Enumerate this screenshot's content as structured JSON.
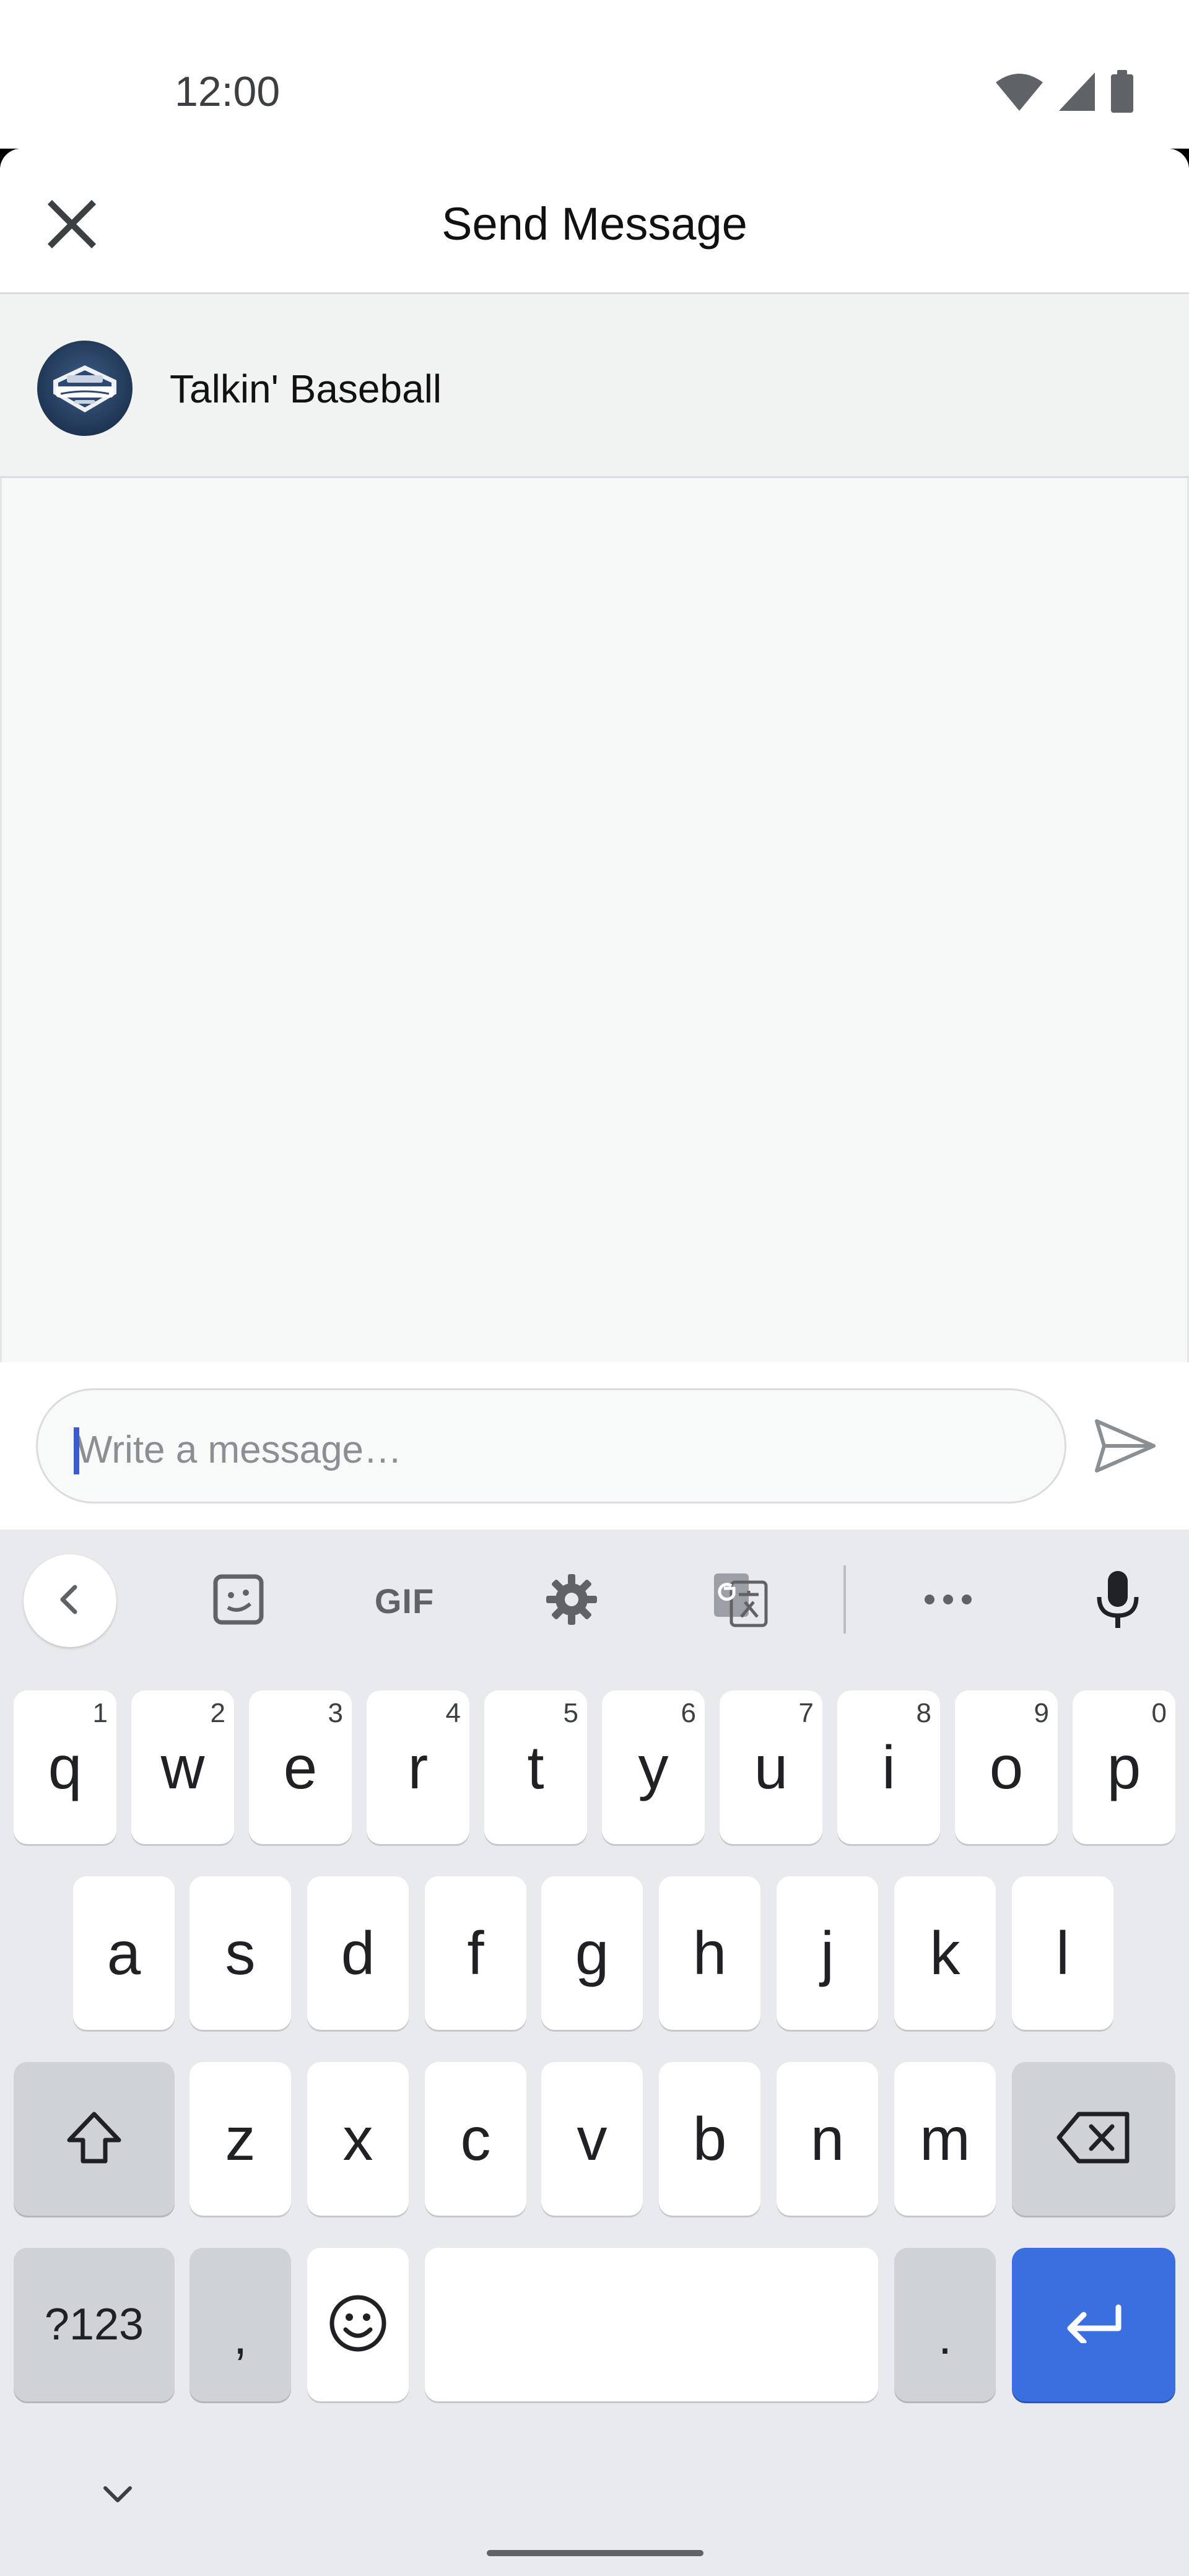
{
  "status_bar": {
    "time": "12:00",
    "icons": [
      "wifi-icon",
      "signal-icon",
      "battery-icon"
    ]
  },
  "dialog": {
    "title": "Send Message",
    "close_icon": "close-icon"
  },
  "recipient": {
    "name": "Talkin' Baseball",
    "avatar_text": "TALKIN' Baseball"
  },
  "compose": {
    "placeholder": "Write a message…",
    "send_icon": "send-icon"
  },
  "keyboard": {
    "toolbar": [
      "chevron-left-icon",
      "sticker-icon",
      "GIF",
      "gear-icon",
      "translate-icon",
      "more-icon",
      "mic-icon"
    ],
    "row1": [
      {
        "key": "q",
        "hint": "1"
      },
      {
        "key": "w",
        "hint": "2"
      },
      {
        "key": "e",
        "hint": "3"
      },
      {
        "key": "r",
        "hint": "4"
      },
      {
        "key": "t",
        "hint": "5"
      },
      {
        "key": "y",
        "hint": "6"
      },
      {
        "key": "u",
        "hint": "7"
      },
      {
        "key": "i",
        "hint": "8"
      },
      {
        "key": "o",
        "hint": "9"
      },
      {
        "key": "p",
        "hint": "0"
      }
    ],
    "row2": [
      "a",
      "s",
      "d",
      "f",
      "g",
      "h",
      "j",
      "k",
      "l"
    ],
    "row3": [
      "z",
      "x",
      "c",
      "v",
      "b",
      "n",
      "m"
    ],
    "symbols_label": "?123",
    "comma": ",",
    "period": "."
  },
  "colors": {
    "accent": "#3b6fe0",
    "keyboard_bg": "#e8eaed",
    "sheet_bg": "#f7f8f8"
  }
}
